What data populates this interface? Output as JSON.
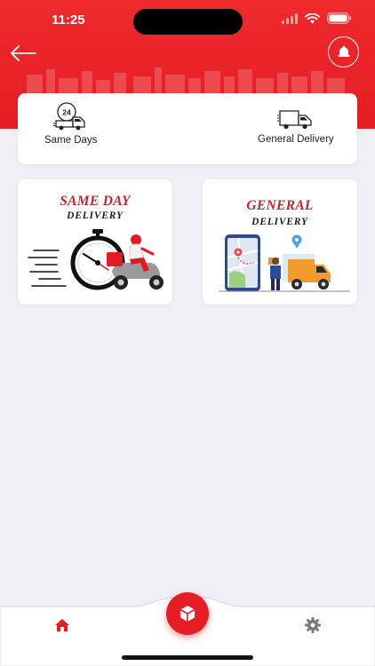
{
  "status_bar": {
    "time": "11:25"
  },
  "header": {
    "back_icon": "arrow-left-icon",
    "bell_icon": "bell-icon"
  },
  "top_options": {
    "same_days_label": "Same Days",
    "general_delivery_label": "General Delivery",
    "clock_badge": "24"
  },
  "services": {
    "same_day": {
      "title": "SAME DAY",
      "subtitle": "DELIVERY"
    },
    "general": {
      "title": "GENERAL",
      "subtitle": "DELIVERY"
    }
  },
  "tabbar": {
    "home_icon": "home-icon",
    "center_icon": "box-icon",
    "settings_icon": "gear-icon"
  },
  "colors": {
    "brand_red": "#e51d24",
    "title_red": "#c0272d",
    "background": "#f0eff5"
  }
}
